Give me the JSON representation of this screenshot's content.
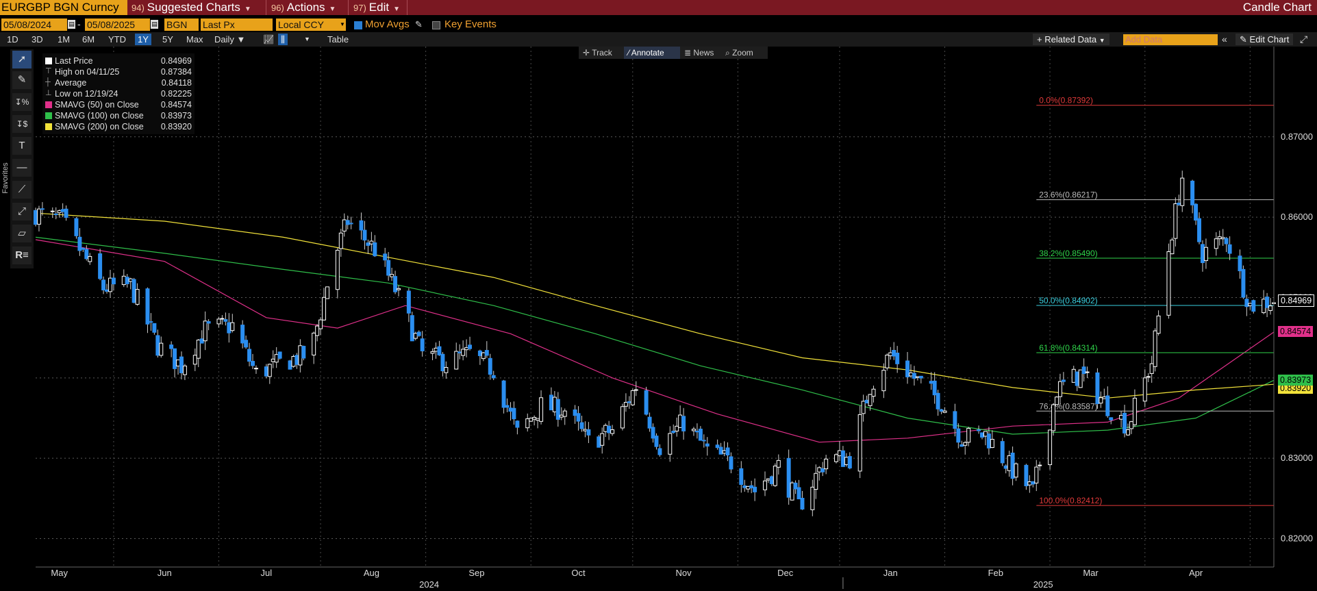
{
  "topbar": {
    "ticker": "EURGBP BGN Curncy",
    "menus": [
      {
        "num": "94)",
        "label": "Suggested Charts"
      },
      {
        "num": "96)",
        "label": "Actions"
      },
      {
        "num": "97)",
        "label": "Edit"
      }
    ],
    "title": "Candle Chart"
  },
  "controls": {
    "start_date": "05/08/2024",
    "date_sep": "-",
    "end_date": "05/08/2025",
    "source": "BGN",
    "field": "Last Px",
    "currency": "Local CCY",
    "mov_avgs_label": "Mov Avgs",
    "mov_avgs_checked": true,
    "key_events_label": "Key Events",
    "key_events_checked": false
  },
  "periods": [
    "1D",
    "3D",
    "1M",
    "6M",
    "YTD",
    "1Y",
    "5Y",
    "Max"
  ],
  "selected_period": "1Y",
  "frequency": "Daily",
  "table_label": "Table",
  "right_controls": {
    "related_data": "+ Related Data",
    "add_data_placeholder": "Add Data",
    "edit_chart": "Edit Chart"
  },
  "annotation_bar": [
    "Track",
    "Annotate",
    "News",
    "Zoom"
  ],
  "annotation_selected": "Annotate",
  "favorites_label": "Favorites",
  "legend": [
    {
      "label": "Last Price",
      "value": "0.84969",
      "color": "#ffffff"
    },
    {
      "label": "High on 04/11/25",
      "value": "0.87384",
      "color": "none"
    },
    {
      "label": "Average",
      "value": "0.84118",
      "color": "none"
    },
    {
      "label": "Low on 12/19/24",
      "value": "0.82225",
      "color": "none"
    },
    {
      "label": "SMAVG (50)  on Close",
      "value": "0.84574",
      "color": "#e0308a"
    },
    {
      "label": "SMAVG (100)  on Close",
      "value": "0.83973",
      "color": "#2fbf4a"
    },
    {
      "label": "SMAVG (200)  on Close",
      "value": "0.83920",
      "color": "#f2e23a"
    }
  ],
  "colors": {
    "up_candle": "#ffffff",
    "down_candle": "#2b8ef0",
    "sma50": "#e0308a",
    "sma100": "#2fbf4a",
    "sma200": "#f2e23a",
    "fib_extreme": "#e23a3a",
    "fib_mid": "#2fd44a",
    "fib_50": "#3ad0e0",
    "fib_other": "#bbbbbb",
    "accent": "#e8a21a",
    "topbar": "#7a1822"
  },
  "chart_data": {
    "type": "candlestick",
    "series_name": "EURGBP",
    "ylim": [
      0.818,
      0.8785
    ],
    "yticks": [
      "0.82000",
      "0.83000",
      "0.84000",
      "0.85000",
      "0.86000",
      "0.87000"
    ],
    "x_range": [
      "2024-05-08",
      "2025-05-08"
    ],
    "months": [
      {
        "label": "May",
        "date": "2024-05-15"
      },
      {
        "label": "Jun",
        "date": "2024-06-15"
      },
      {
        "label": "Jul",
        "date": "2024-07-15"
      },
      {
        "label": "Aug",
        "date": "2024-08-15"
      },
      {
        "label": "Sep",
        "date": "2024-09-15"
      },
      {
        "label": "Oct",
        "date": "2024-10-15"
      },
      {
        "label": "Nov",
        "date": "2024-11-15"
      },
      {
        "label": "Dec",
        "date": "2024-12-15"
      },
      {
        "label": "Jan",
        "date": "2025-01-15"
      },
      {
        "label": "Feb",
        "date": "2025-02-15"
      },
      {
        "label": "Mar",
        "date": "2025-03-15"
      },
      {
        "label": "Apr",
        "date": "2025-04-15"
      }
    ],
    "years": [
      {
        "label": "2024",
        "date": "2024-09-01"
      },
      {
        "label": "2025",
        "date": "2025-03-01"
      }
    ],
    "close_path": [
      [
        "2024-05-08",
        0.8605
      ],
      [
        "2024-05-16",
        0.8595
      ],
      [
        "2024-05-28",
        0.8512
      ],
      [
        "2024-06-05",
        0.8515
      ],
      [
        "2024-06-13",
        0.844
      ],
      [
        "2024-06-20",
        0.8415
      ],
      [
        "2024-06-27",
        0.846
      ],
      [
        "2024-07-05",
        0.8465
      ],
      [
        "2024-07-12",
        0.8405
      ],
      [
        "2024-07-20",
        0.842
      ],
      [
        "2024-07-28",
        0.843
      ],
      [
        "2024-08-04",
        0.855
      ],
      [
        "2024-08-08",
        0.8595
      ],
      [
        "2024-08-16",
        0.856
      ],
      [
        "2024-08-22",
        0.851
      ],
      [
        "2024-08-30",
        0.843
      ],
      [
        "2024-09-06",
        0.842
      ],
      [
        "2024-09-13",
        0.843
      ],
      [
        "2024-09-20",
        0.841
      ],
      [
        "2024-09-27",
        0.833
      ],
      [
        "2024-10-04",
        0.8365
      ],
      [
        "2024-10-11",
        0.836
      ],
      [
        "2024-10-18",
        0.832
      ],
      [
        "2024-10-25",
        0.8335
      ],
      [
        "2024-11-01",
        0.839
      ],
      [
        "2024-11-08",
        0.8315
      ],
      [
        "2024-11-15",
        0.8345
      ],
      [
        "2024-11-22",
        0.831
      ],
      [
        "2024-11-29",
        0.8295
      ],
      [
        "2024-12-06",
        0.826
      ],
      [
        "2024-12-13",
        0.829
      ],
      [
        "2024-12-19",
        0.824
      ],
      [
        "2024-12-27",
        0.83
      ],
      [
        "2025-01-03",
        0.83
      ],
      [
        "2025-01-09",
        0.839
      ],
      [
        "2025-01-15",
        0.843
      ],
      [
        "2025-01-22",
        0.84
      ],
      [
        "2025-01-30",
        0.837
      ],
      [
        "2025-02-05",
        0.8325
      ],
      [
        "2025-02-12",
        0.833
      ],
      [
        "2025-02-19",
        0.829
      ],
      [
        "2025-02-26",
        0.8258
      ],
      [
        "2025-03-05",
        0.8385
      ],
      [
        "2025-03-12",
        0.8405
      ],
      [
        "2025-03-19",
        0.837
      ],
      [
        "2025-03-26",
        0.834
      ],
      [
        "2025-04-02",
        0.842
      ],
      [
        "2025-04-07",
        0.856
      ],
      [
        "2025-04-11",
        0.865
      ],
      [
        "2025-04-17",
        0.8555
      ],
      [
        "2025-04-24",
        0.8575
      ],
      [
        "2025-05-01",
        0.849
      ],
      [
        "2025-05-08",
        0.8497
      ]
    ],
    "sma": [
      {
        "name": "SMAVG (50)",
        "points": [
          [
            "2024-05-08",
            0.8572
          ],
          [
            "2024-06-15",
            0.8545
          ],
          [
            "2024-07-15",
            0.8475
          ],
          [
            "2024-08-05",
            0.8462
          ],
          [
            "2024-08-25",
            0.849
          ],
          [
            "2024-09-25",
            0.8455
          ],
          [
            "2024-10-25",
            0.84
          ],
          [
            "2024-11-25",
            0.8355
          ],
          [
            "2024-12-25",
            0.832
          ],
          [
            "2025-01-20",
            0.8325
          ],
          [
            "2025-02-20",
            0.834
          ],
          [
            "2025-03-20",
            0.8345
          ],
          [
            "2025-04-10",
            0.8375
          ],
          [
            "2025-05-08",
            0.8457
          ]
        ]
      },
      {
        "name": "SMAVG (100)",
        "points": [
          [
            "2024-05-08",
            0.8575
          ],
          [
            "2024-06-15",
            0.8555
          ],
          [
            "2024-07-20",
            0.8535
          ],
          [
            "2024-08-20",
            0.8518
          ],
          [
            "2024-09-20",
            0.849
          ],
          [
            "2024-10-20",
            0.8455
          ],
          [
            "2024-11-20",
            0.8415
          ],
          [
            "2024-12-20",
            0.8385
          ],
          [
            "2025-01-20",
            0.835
          ],
          [
            "2025-02-20",
            0.833
          ],
          [
            "2025-03-20",
            0.8335
          ],
          [
            "2025-04-15",
            0.835
          ],
          [
            "2025-05-08",
            0.8397
          ]
        ]
      },
      {
        "name": "SMAVG (200)",
        "points": [
          [
            "2024-05-08",
            0.8605
          ],
          [
            "2024-06-15",
            0.8595
          ],
          [
            "2024-07-20",
            0.8575
          ],
          [
            "2024-08-20",
            0.855
          ],
          [
            "2024-09-20",
            0.8525
          ],
          [
            "2024-10-20",
            0.849
          ],
          [
            "2024-11-20",
            0.8455
          ],
          [
            "2024-12-20",
            0.8425
          ],
          [
            "2025-01-20",
            0.841
          ],
          [
            "2025-02-20",
            0.8388
          ],
          [
            "2025-03-20",
            0.8375
          ],
          [
            "2025-04-15",
            0.8385
          ],
          [
            "2025-05-08",
            0.8392
          ]
        ]
      }
    ],
    "fibonacci": {
      "start_date": "2025-02-27",
      "levels": [
        {
          "label": "0.0%(0.87392)",
          "value": 0.87392
        },
        {
          "label": "23.6%(0.86217)",
          "value": 0.86217
        },
        {
          "label": "38.2%(0.85490)",
          "value": 0.8549
        },
        {
          "label": "50.0%(0.84902)",
          "value": 0.84902
        },
        {
          "label": "61.8%(0.84314)",
          "value": 0.84314
        },
        {
          "label": "76.4%(0.83587)",
          "value": 0.83587
        },
        {
          "label": "100.0%(0.82412)",
          "value": 0.82412
        }
      ]
    },
    "last_price_tags": [
      {
        "label": "0.84969",
        "value": 0.84969
      },
      {
        "label": "0.84574",
        "value": 0.84574
      },
      {
        "label": "0.83973",
        "value": 0.83973
      },
      {
        "label": "0.83920",
        "value": 0.8392
      }
    ]
  }
}
